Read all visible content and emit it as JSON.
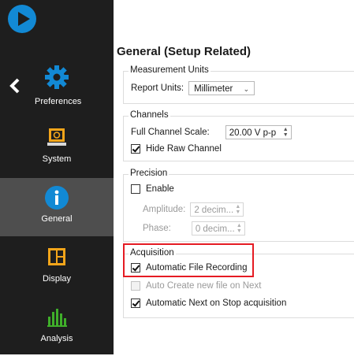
{
  "sidebar": {
    "items": [
      {
        "label": "Preferences",
        "icon": "gear-icon"
      },
      {
        "label": "System",
        "icon": "monitor-icon"
      },
      {
        "label": "General",
        "icon": "info-icon",
        "active": true
      },
      {
        "label": "Display",
        "icon": "display-layout-icon"
      },
      {
        "label": "Analysis",
        "icon": "bar-chart-icon"
      }
    ],
    "accent": "#1289d4",
    "bg": "#1e1e1e",
    "active_bg": "#4e4e4e"
  },
  "page": {
    "title": "General (Setup Related)"
  },
  "measurement": {
    "title": "Measurement Units",
    "report_units_label": "Report Units:",
    "report_units_value": "Millimeter"
  },
  "channels": {
    "title": "Channels",
    "full_scale_label": "Full Channel Scale:",
    "full_scale_value": "20.00 V p-p",
    "hide_raw_label": "Hide Raw Channel",
    "hide_raw_checked": true
  },
  "precision": {
    "title": "Precision",
    "enable_label": "Enable",
    "enable_checked": false,
    "amplitude_label": "Amplitude:",
    "amplitude_value": "2 decim...",
    "phase_label": "Phase:",
    "phase_value": "0 decim..."
  },
  "acquisition": {
    "title": "Acquisition",
    "auto_file_label": "Automatic File Recording",
    "auto_file_checked": true,
    "auto_create_label": "Auto Create new file on Next",
    "auto_create_checked": false,
    "auto_next_label": "Automatic Next on Stop acquisition",
    "auto_next_checked": true,
    "highlight_color": "#e51b23"
  }
}
